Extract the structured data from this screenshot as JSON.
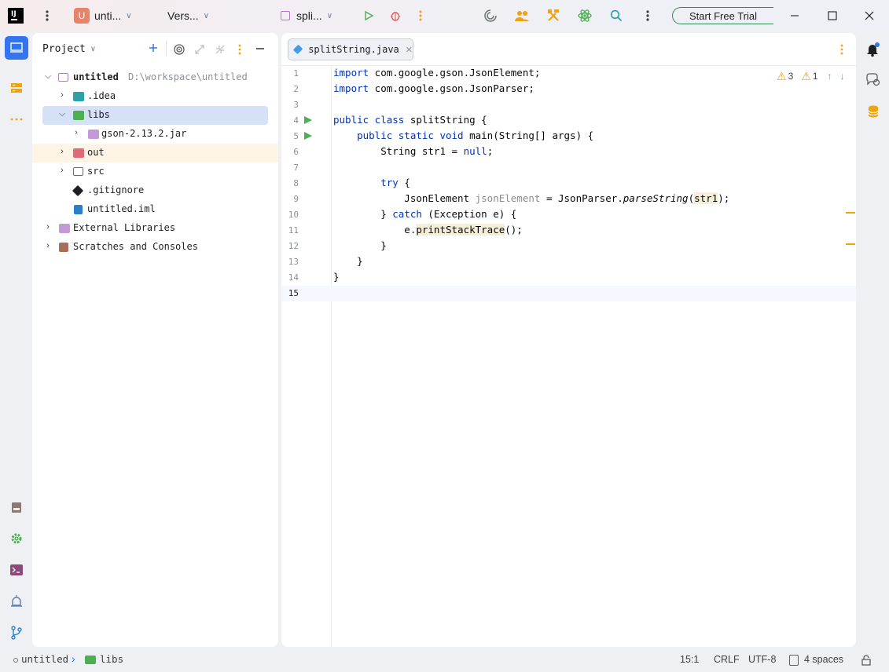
{
  "titlebar": {
    "project_badge": "U",
    "project_name": "unti...",
    "vcs": "Vers...",
    "run_config": "spli...",
    "trial_button": "Start Free Trial"
  },
  "project_panel": {
    "title": "Project",
    "tree": [
      {
        "label": "untitled",
        "hint": "D:\\workspace\\untitled"
      },
      {
        "label": ".idea"
      },
      {
        "label": "libs"
      },
      {
        "label": "gson-2.13.2.jar"
      },
      {
        "label": "out"
      },
      {
        "label": "src"
      },
      {
        "label": ".gitignore"
      },
      {
        "label": "untitled.iml"
      },
      {
        "label": "External Libraries"
      },
      {
        "label": "Scratches and Consoles"
      }
    ]
  },
  "editor": {
    "tab_label": "splitString.java",
    "warnings": "3",
    "weak_warnings": "1",
    "line_numbers": [
      "1",
      "2",
      "3",
      "4",
      "5",
      "6",
      "7",
      "8",
      "9",
      "10",
      "11",
      "12",
      "13",
      "14",
      "15"
    ],
    "lines": {
      "l1_kw": "import",
      "l1_rest": " com.google.gson.JsonElement;",
      "l2_kw": "import",
      "l2_rest": " com.google.gson.JsonParser;",
      "l4_kw": "public class",
      "l4_rest": " splitString {",
      "l5_kw": "    public static void",
      "l5_rest": " main(String[] args) {",
      "l6_a": "        String str1 = ",
      "l6_kw": "null",
      "l6_b": ";",
      "l8_kw": "        try",
      "l8_rest": " {",
      "l9_a": "            JsonElement ",
      "l9_dim": "jsonElement",
      "l9_b": " = JsonParser.",
      "l9_it": "parseString",
      "l9_c": "(",
      "l9_hl": "str1",
      "l9_d": ");",
      "l10_a": "        } ",
      "l10_kw": "catch",
      "l10_b": " (Exception e) {",
      "l11_a": "            e.",
      "l11_hl": "printStackTrace",
      "l11_b": "();",
      "l12": "        }",
      "l13": "    }",
      "l14": "}"
    }
  },
  "statusbar": {
    "crumb_project": "untitled",
    "crumb_folder": "libs",
    "position": "15:1",
    "line_sep": "CRLF",
    "encoding": "UTF-8",
    "indent": "4 spaces"
  },
  "colors": {
    "accent": "#3574f0",
    "run_green": "#4caf50",
    "warning": "#f0a30a"
  }
}
